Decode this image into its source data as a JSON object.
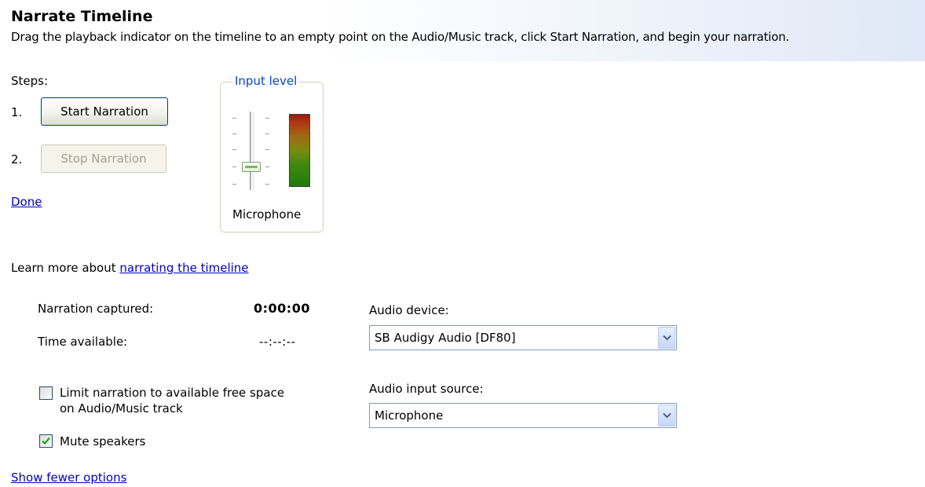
{
  "header": {
    "title": "Narrate Timeline",
    "instructions": "Drag the playback indicator on the timeline to an empty point on the Audio/Music track, click Start Narration, and begin your narration."
  },
  "steps": {
    "label": "Steps:",
    "step1_number": "1.",
    "step1_button": "Start Narration",
    "step2_number": "2.",
    "step2_button": "Stop Narration",
    "done_link": "Done"
  },
  "input_level": {
    "legend": "Input level",
    "source_label": "Microphone",
    "slider_level_fraction": 0.7,
    "meter_colors": [
      "#9a1a0e",
      "#7a8a10",
      "#1f7a0a"
    ]
  },
  "learn_more": {
    "prefix": "Learn more about",
    "link": "narrating the timeline"
  },
  "narration": {
    "captured_label": "Narration captured:",
    "captured_value": "0:00:00",
    "available_label": "Time available:",
    "available_value": "--:--:--"
  },
  "options": {
    "limit_label_line1": "Limit narration to available free space",
    "limit_label_line2": "on Audio/Music track",
    "limit_checked": false,
    "mute_label": "Mute speakers",
    "mute_checked": true,
    "show_fewer_link": "Show fewer options"
  },
  "audio": {
    "device_label": "Audio device:",
    "device_value": "SB Audigy Audio [DF80]",
    "input_source_label": "Audio input source:",
    "input_source_value": "Microphone"
  },
  "colors": {
    "link": "#0000cc",
    "legend": "#0046d5",
    "header_gradient_end": "#dfe8f6"
  }
}
